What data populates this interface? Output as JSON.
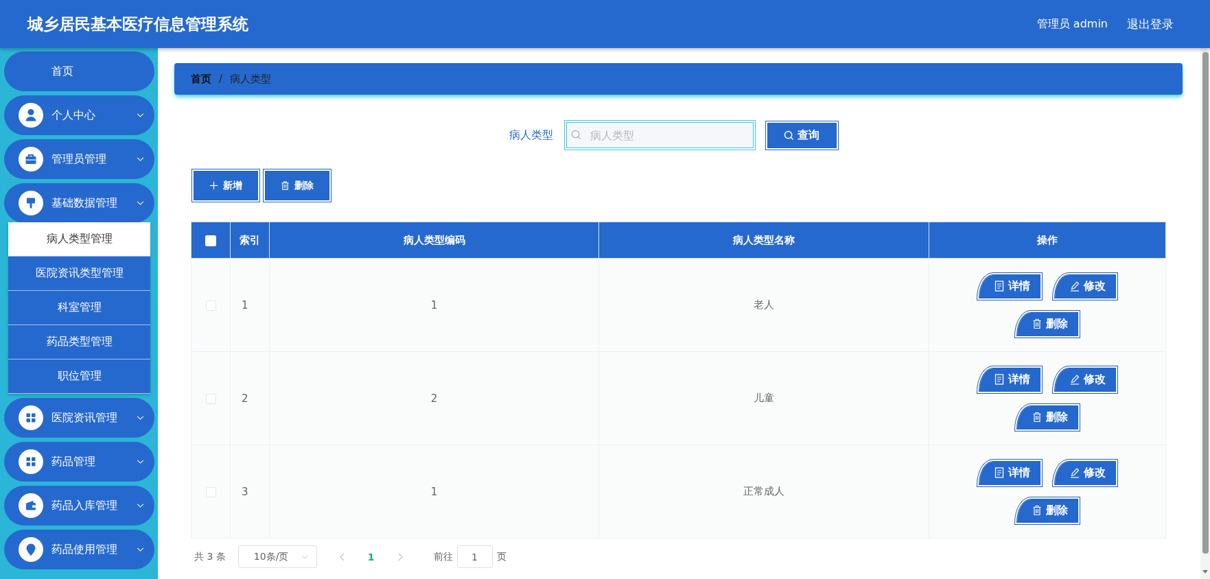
{
  "header": {
    "title": "城乡居民基本医疗信息管理系统",
    "user": "管理员 admin",
    "logout": "退出登录"
  },
  "sidebar": {
    "items": [
      {
        "label": "首页",
        "kind": "link",
        "selected": false
      },
      {
        "label": "个人中心",
        "kind": "group",
        "selected": false
      },
      {
        "label": "管理员管理",
        "kind": "group",
        "selected": false
      },
      {
        "label": "基础数据管理",
        "kind": "group",
        "selected": false,
        "children": [
          {
            "label": "病人类型管理",
            "selected": true
          },
          {
            "label": "医院资讯类型管理",
            "selected": false
          },
          {
            "label": "科室管理",
            "selected": false
          },
          {
            "label": "药品类型管理",
            "selected": false
          },
          {
            "label": "职位管理",
            "selected": false
          }
        ]
      },
      {
        "label": "医院资讯管理",
        "kind": "group",
        "selected": false
      },
      {
        "label": "药品管理",
        "kind": "group",
        "selected": false
      },
      {
        "label": "药品入库管理",
        "kind": "group",
        "selected": false
      },
      {
        "label": "药品使用管理",
        "kind": "group",
        "selected": false
      }
    ]
  },
  "breadcrumb": {
    "items": [
      "首页",
      "病人类型"
    ],
    "separator": "/"
  },
  "search": {
    "label": "病人类型",
    "placeholder": "病人类型",
    "button": "查询"
  },
  "toolbar": [
    {
      "label": "新增",
      "kind": "add"
    },
    {
      "label": "删除",
      "kind": "delete"
    }
  ],
  "table": {
    "select_all": {
      "checked": false
    },
    "columns": [
      "索引",
      "病人类型编码",
      "病人类型名称",
      "操作"
    ],
    "rows": [
      {
        "checked": false,
        "cells": [
          "1",
          "1",
          "老人"
        ],
        "actions": [
          {
            "label": "详情",
            "kind": "detail"
          },
          {
            "label": "修改",
            "kind": "edit"
          },
          {
            "label": "删除",
            "kind": "delete"
          }
        ]
      },
      {
        "checked": false,
        "cells": [
          "2",
          "2",
          "儿童"
        ],
        "actions": [
          {
            "label": "详情",
            "kind": "detail"
          },
          {
            "label": "修改",
            "kind": "edit"
          },
          {
            "label": "删除",
            "kind": "delete"
          }
        ]
      },
      {
        "checked": false,
        "cells": [
          "3",
          "1",
          "正常成人"
        ],
        "actions": [
          {
            "label": "详情",
            "kind": "detail"
          },
          {
            "label": "修改",
            "kind": "edit"
          },
          {
            "label": "删除",
            "kind": "delete"
          }
        ]
      }
    ]
  },
  "pagination": {
    "total": "共 3 条",
    "page_size": "10条/页",
    "pages": [
      {
        "label": "1",
        "selected": true
      }
    ],
    "goto_label": "前往",
    "goto_value": "1",
    "goto_suffix": "页"
  }
}
